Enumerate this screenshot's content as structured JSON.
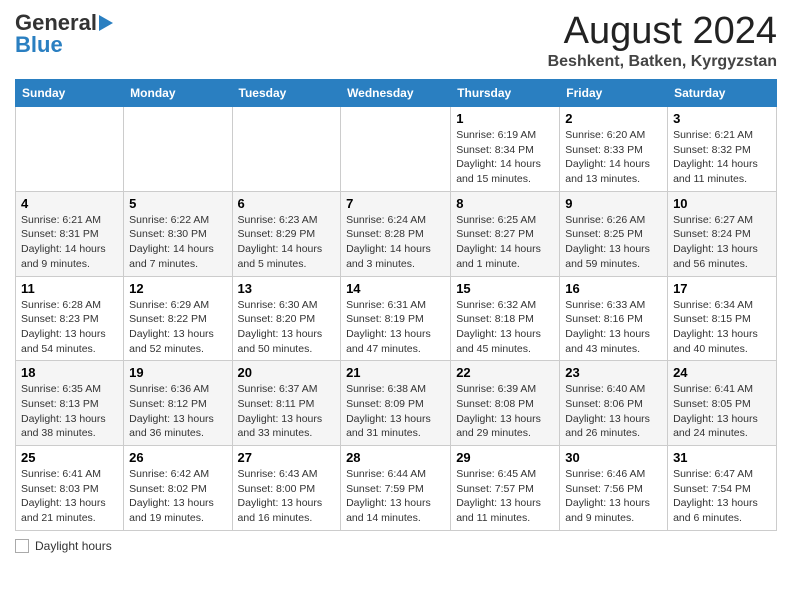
{
  "header": {
    "logo_line1": "General",
    "logo_line2": "Blue",
    "month_title": "August 2024",
    "location": "Beshkent, Batken, Kyrgyzstan"
  },
  "days_of_week": [
    "Sunday",
    "Monday",
    "Tuesday",
    "Wednesday",
    "Thursday",
    "Friday",
    "Saturday"
  ],
  "weeks": [
    [
      {
        "num": "",
        "info": ""
      },
      {
        "num": "",
        "info": ""
      },
      {
        "num": "",
        "info": ""
      },
      {
        "num": "",
        "info": ""
      },
      {
        "num": "1",
        "info": "Sunrise: 6:19 AM\nSunset: 8:34 PM\nDaylight: 14 hours and 15 minutes."
      },
      {
        "num": "2",
        "info": "Sunrise: 6:20 AM\nSunset: 8:33 PM\nDaylight: 14 hours and 13 minutes."
      },
      {
        "num": "3",
        "info": "Sunrise: 6:21 AM\nSunset: 8:32 PM\nDaylight: 14 hours and 11 minutes."
      }
    ],
    [
      {
        "num": "4",
        "info": "Sunrise: 6:21 AM\nSunset: 8:31 PM\nDaylight: 14 hours and 9 minutes."
      },
      {
        "num": "5",
        "info": "Sunrise: 6:22 AM\nSunset: 8:30 PM\nDaylight: 14 hours and 7 minutes."
      },
      {
        "num": "6",
        "info": "Sunrise: 6:23 AM\nSunset: 8:29 PM\nDaylight: 14 hours and 5 minutes."
      },
      {
        "num": "7",
        "info": "Sunrise: 6:24 AM\nSunset: 8:28 PM\nDaylight: 14 hours and 3 minutes."
      },
      {
        "num": "8",
        "info": "Sunrise: 6:25 AM\nSunset: 8:27 PM\nDaylight: 14 hours and 1 minute."
      },
      {
        "num": "9",
        "info": "Sunrise: 6:26 AM\nSunset: 8:25 PM\nDaylight: 13 hours and 59 minutes."
      },
      {
        "num": "10",
        "info": "Sunrise: 6:27 AM\nSunset: 8:24 PM\nDaylight: 13 hours and 56 minutes."
      }
    ],
    [
      {
        "num": "11",
        "info": "Sunrise: 6:28 AM\nSunset: 8:23 PM\nDaylight: 13 hours and 54 minutes."
      },
      {
        "num": "12",
        "info": "Sunrise: 6:29 AM\nSunset: 8:22 PM\nDaylight: 13 hours and 52 minutes."
      },
      {
        "num": "13",
        "info": "Sunrise: 6:30 AM\nSunset: 8:20 PM\nDaylight: 13 hours and 50 minutes."
      },
      {
        "num": "14",
        "info": "Sunrise: 6:31 AM\nSunset: 8:19 PM\nDaylight: 13 hours and 47 minutes."
      },
      {
        "num": "15",
        "info": "Sunrise: 6:32 AM\nSunset: 8:18 PM\nDaylight: 13 hours and 45 minutes."
      },
      {
        "num": "16",
        "info": "Sunrise: 6:33 AM\nSunset: 8:16 PM\nDaylight: 13 hours and 43 minutes."
      },
      {
        "num": "17",
        "info": "Sunrise: 6:34 AM\nSunset: 8:15 PM\nDaylight: 13 hours and 40 minutes."
      }
    ],
    [
      {
        "num": "18",
        "info": "Sunrise: 6:35 AM\nSunset: 8:13 PM\nDaylight: 13 hours and 38 minutes."
      },
      {
        "num": "19",
        "info": "Sunrise: 6:36 AM\nSunset: 8:12 PM\nDaylight: 13 hours and 36 minutes."
      },
      {
        "num": "20",
        "info": "Sunrise: 6:37 AM\nSunset: 8:11 PM\nDaylight: 13 hours and 33 minutes."
      },
      {
        "num": "21",
        "info": "Sunrise: 6:38 AM\nSunset: 8:09 PM\nDaylight: 13 hours and 31 minutes."
      },
      {
        "num": "22",
        "info": "Sunrise: 6:39 AM\nSunset: 8:08 PM\nDaylight: 13 hours and 29 minutes."
      },
      {
        "num": "23",
        "info": "Sunrise: 6:40 AM\nSunset: 8:06 PM\nDaylight: 13 hours and 26 minutes."
      },
      {
        "num": "24",
        "info": "Sunrise: 6:41 AM\nSunset: 8:05 PM\nDaylight: 13 hours and 24 minutes."
      }
    ],
    [
      {
        "num": "25",
        "info": "Sunrise: 6:41 AM\nSunset: 8:03 PM\nDaylight: 13 hours and 21 minutes."
      },
      {
        "num": "26",
        "info": "Sunrise: 6:42 AM\nSunset: 8:02 PM\nDaylight: 13 hours and 19 minutes."
      },
      {
        "num": "27",
        "info": "Sunrise: 6:43 AM\nSunset: 8:00 PM\nDaylight: 13 hours and 16 minutes."
      },
      {
        "num": "28",
        "info": "Sunrise: 6:44 AM\nSunset: 7:59 PM\nDaylight: 13 hours and 14 minutes."
      },
      {
        "num": "29",
        "info": "Sunrise: 6:45 AM\nSunset: 7:57 PM\nDaylight: 13 hours and 11 minutes."
      },
      {
        "num": "30",
        "info": "Sunrise: 6:46 AM\nSunset: 7:56 PM\nDaylight: 13 hours and 9 minutes."
      },
      {
        "num": "31",
        "info": "Sunrise: 6:47 AM\nSunset: 7:54 PM\nDaylight: 13 hours and 6 minutes."
      }
    ]
  ],
  "footer": {
    "label": "Daylight hours"
  }
}
